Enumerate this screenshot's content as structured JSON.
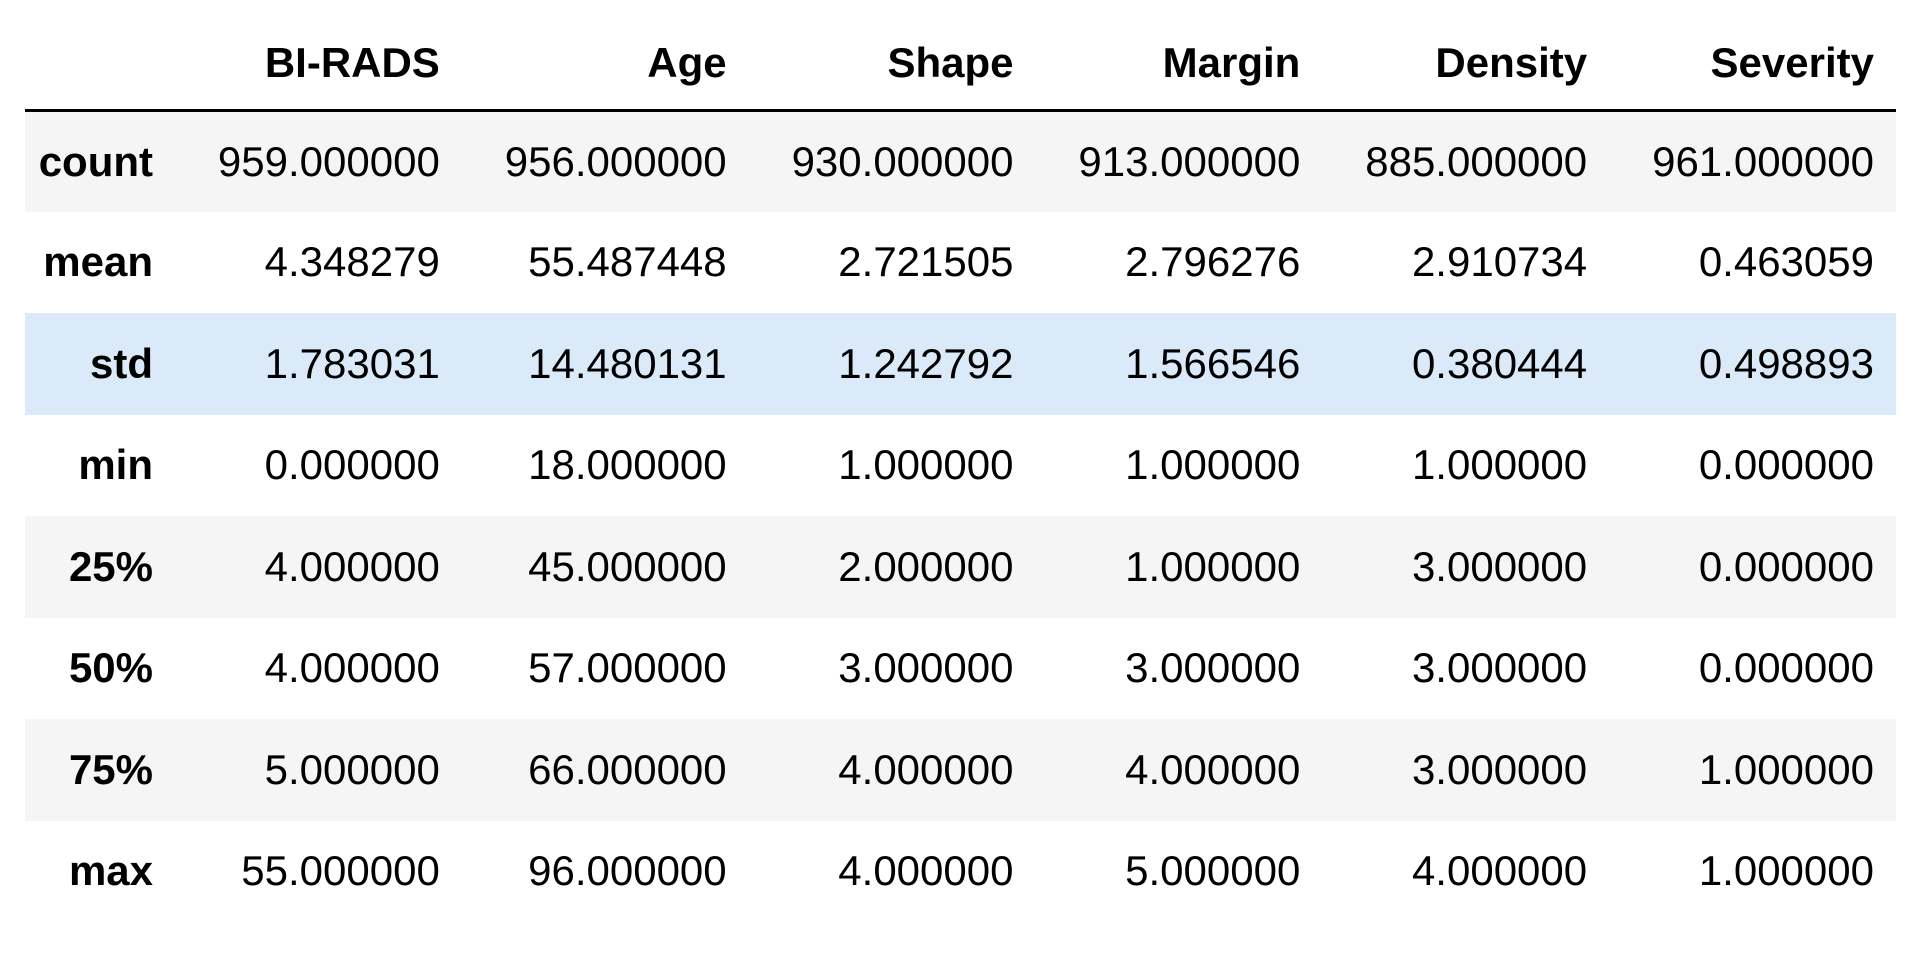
{
  "table": {
    "columns": [
      "BI-RADS",
      "Age",
      "Shape",
      "Margin",
      "Density",
      "Severity"
    ],
    "rows": [
      {
        "index": "count",
        "values": [
          "959.000000",
          "956.000000",
          "930.000000",
          "913.000000",
          "885.000000",
          "961.000000"
        ]
      },
      {
        "index": "mean",
        "values": [
          "4.348279",
          "55.487448",
          "2.721505",
          "2.796276",
          "2.910734",
          "0.463059"
        ]
      },
      {
        "index": "std",
        "values": [
          "1.783031",
          "14.480131",
          "1.242792",
          "1.566546",
          "0.380444",
          "0.498893"
        ]
      },
      {
        "index": "min",
        "values": [
          "0.000000",
          "18.000000",
          "1.000000",
          "1.000000",
          "1.000000",
          "0.000000"
        ]
      },
      {
        "index": "25%",
        "values": [
          "4.000000",
          "45.000000",
          "2.000000",
          "1.000000",
          "3.000000",
          "0.000000"
        ]
      },
      {
        "index": "50%",
        "values": [
          "4.000000",
          "57.000000",
          "3.000000",
          "3.000000",
          "3.000000",
          "0.000000"
        ]
      },
      {
        "index": "75%",
        "values": [
          "5.000000",
          "66.000000",
          "4.000000",
          "4.000000",
          "3.000000",
          "1.000000"
        ]
      },
      {
        "index": "max",
        "values": [
          "55.000000",
          "96.000000",
          "4.000000",
          "5.000000",
          "4.000000",
          "1.000000"
        ]
      }
    ]
  },
  "colors": {
    "stripe": "#f5f5f5",
    "highlight": "#dbeaf8",
    "header_rule": "#000000"
  },
  "highlighted_row": "std"
}
